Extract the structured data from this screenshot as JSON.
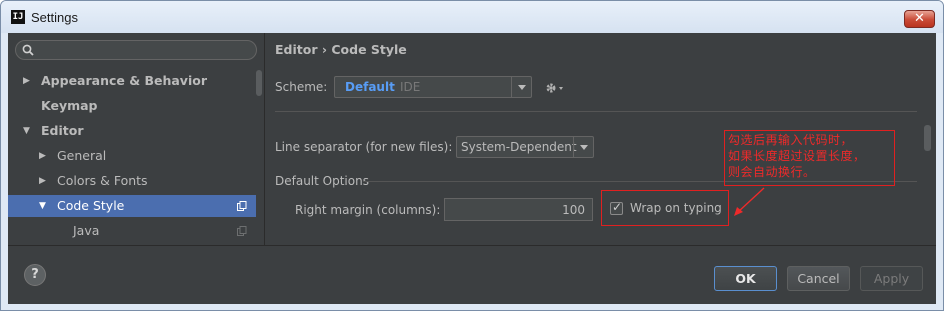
{
  "window": {
    "title": "Settings",
    "app_icon_text": "IJ",
    "close_glyph": "✕"
  },
  "sidebar": {
    "search_placeholder": "",
    "items": [
      {
        "label": "Appearance & Behavior",
        "expanded": false
      },
      {
        "label": "Keymap"
      },
      {
        "label": "Editor",
        "expanded": true
      },
      {
        "label": "General",
        "expanded": false
      },
      {
        "label": "Colors & Fonts",
        "expanded": false
      },
      {
        "label": "Code Style",
        "expanded": true,
        "selected": true
      },
      {
        "label": "Java"
      }
    ]
  },
  "main": {
    "breadcrumb": "Editor › Code Style",
    "scheme_label": "Scheme:",
    "scheme_value": "Default",
    "scheme_sub": "IDE",
    "line_separator_label": "Line separator (for new files):",
    "line_separator_value": "System-Dependent",
    "default_options_title": "Default Options",
    "right_margin_label": "Right margin (columns):",
    "right_margin_value": "100",
    "wrap_on_typing_label": "Wrap on typing",
    "wrap_on_typing_checked": true
  },
  "annotation": {
    "lines": [
      "勾选后再输入代码时，",
      "如果长度超过设置长度，",
      "则会自动换行。"
    ],
    "color": "#ee2a2a"
  },
  "footer": {
    "help_glyph": "?",
    "ok_label": "OK",
    "cancel_label": "Cancel",
    "apply_label": "Apply"
  },
  "colors": {
    "background": "#3c3f41",
    "selection": "#4b6eaf",
    "accent_link": "#589df6"
  }
}
